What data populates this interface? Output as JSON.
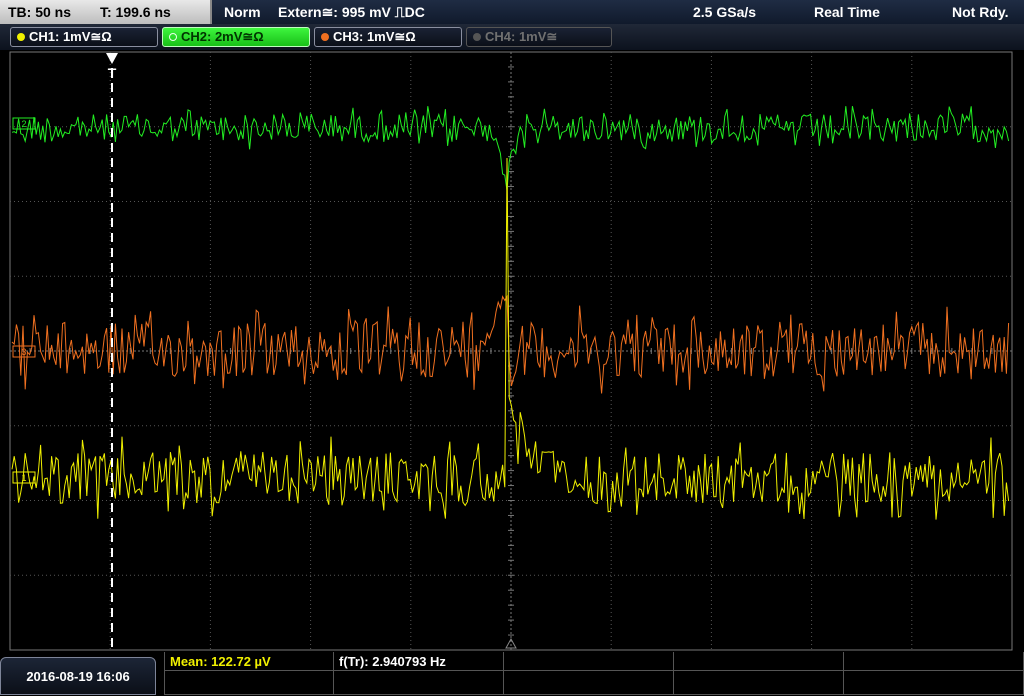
{
  "topbar": {
    "timebase": "TB: 50 ns",
    "trigger_time": "T: 199.6 ns",
    "trigger_mode": "Norm",
    "trigger_source": "Extern≅: 995 mV ⎍DC",
    "sample_rate": "2.5 GSa/s",
    "acq_mode": "Real Time",
    "status": "Not Rdy."
  },
  "channels": [
    {
      "label": "CH1: 1mV≅Ω",
      "color": "#f0f000",
      "active": false,
      "enabled": true
    },
    {
      "label": "CH2: 2mV≅Ω",
      "color": "#22ee22",
      "active": true,
      "enabled": true
    },
    {
      "label": "CH3: 1mV≅Ω",
      "color": "#f07020",
      "active": false,
      "enabled": true
    },
    {
      "label": "CH4: 1mV≅",
      "color": "#707070",
      "active": false,
      "enabled": false
    }
  ],
  "markers": {
    "trigger_marker": "T",
    "ch2_ref": "2",
    "ch3_ref": "3",
    "ch1_ref": "1"
  },
  "bottom": {
    "datetime": "2016-08-19 16:06",
    "mean_label": "Mean: 122.72 µV",
    "freq_label": "f(Tr): 2.940793 Hz"
  },
  "colors": {
    "ch1": "#f0f000",
    "ch2": "#22ee22",
    "ch3": "#f07020",
    "grid": "#555555",
    "trigger_line": "#ffffff"
  }
}
